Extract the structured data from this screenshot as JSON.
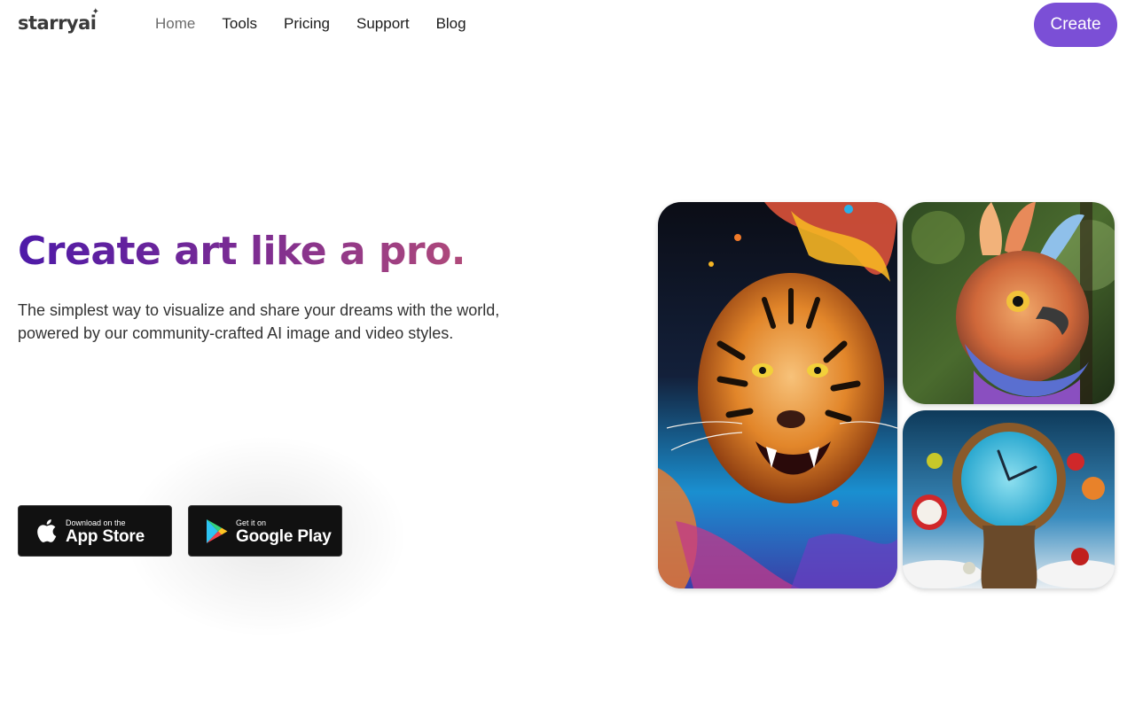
{
  "brand": {
    "name": "starryai"
  },
  "nav": {
    "items": [
      {
        "label": "Home",
        "active": true
      },
      {
        "label": "Tools"
      },
      {
        "label": "Pricing"
      },
      {
        "label": "Support"
      },
      {
        "label": "Blog"
      }
    ],
    "cta_label": "Create"
  },
  "hero": {
    "title": "Create art like a pro.",
    "subtitle": "The simplest way to visualize and share your dreams with the world, powered by our community-crafted AI image and video styles."
  },
  "stores": {
    "apple": {
      "small": "Download on the",
      "big": "App Store"
    },
    "google": {
      "small": "Get it on",
      "big": "Google Play"
    }
  },
  "colors": {
    "accent": "#7b4fd6",
    "title_gradient_start": "#4e1aa8",
    "title_gradient_end": "#b04a7a"
  },
  "gallery": [
    {
      "subject": "tiger-artwork"
    },
    {
      "subject": "bird-artwork"
    },
    {
      "subject": "melting-clock-artwork"
    }
  ]
}
